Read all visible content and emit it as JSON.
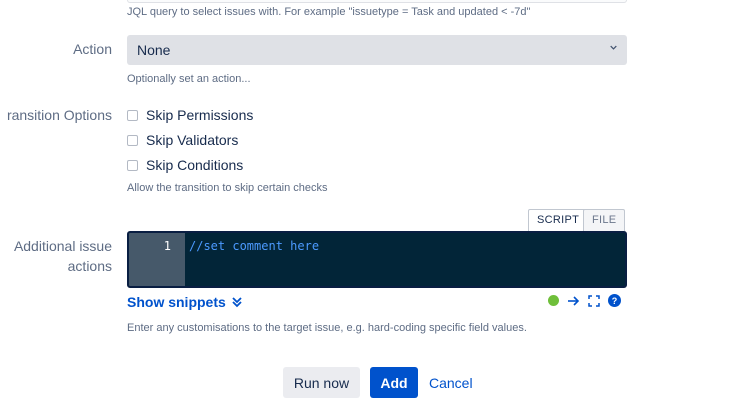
{
  "query": {
    "help": "JQL query to select issues with. For example \"issuetype = Task and updated < -7d\""
  },
  "action": {
    "label": "Action",
    "selected": "None",
    "help": "Optionally set an action..."
  },
  "transition_options": {
    "label": "ransition Options",
    "options": [
      "Skip Permissions",
      "Skip Validators",
      "Skip Conditions"
    ],
    "help": "Allow the transition to skip certain checks"
  },
  "additional_actions": {
    "label_line1": "Additional issue",
    "label_line2": "actions",
    "tabs": [
      "SCRIPT",
      "FILE"
    ],
    "active_tab": "SCRIPT",
    "editor": {
      "line_number": "1",
      "code": "//set comment here"
    },
    "show_snippets": "Show snippets",
    "help": "Enter any customisations to the target issue, e.g. hard-coding specific field values.",
    "status_color": "#6fbf3a"
  },
  "buttons": {
    "run_now": "Run now",
    "add": "Add",
    "cancel": "Cancel"
  },
  "colors": {
    "primary": "#0052cc",
    "editor_bg": "#022538",
    "gutter_bg": "#46596a"
  }
}
